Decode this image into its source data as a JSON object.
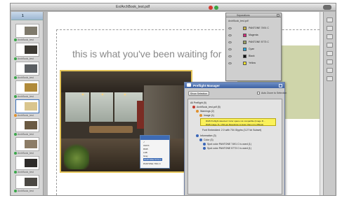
{
  "window": {
    "title": "Ex/ArchBook_test.pdf"
  },
  "pages_panel": {
    "header": "1",
    "thumbnails": [
      {
        "label": "ArchBook_test"
      },
      {
        "label": "ArchBook_test"
      },
      {
        "label": "ArchBook_test"
      },
      {
        "label": "ArchBook_test"
      },
      {
        "label": "ArchBook_test"
      },
      {
        "label": "ArchBook_test"
      },
      {
        "label": "ArchBook_test"
      },
      {
        "label": "ArchBook_test"
      },
      {
        "label": "ArchBook_test"
      }
    ]
  },
  "document": {
    "headline": "this is what you've been waiting for"
  },
  "separations": {
    "title": "Separations",
    "file": "ArchBook_test.pdf",
    "inks": [
      {
        "name": "PANTONE 7491 C",
        "color": "#c8b64a"
      },
      {
        "name": "Magenta",
        "color": "#d62a7a"
      },
      {
        "name": "PANTONE 5773 C",
        "color": "#9aa060"
      },
      {
        "name": "Cyan",
        "color": "#25a7de"
      },
      {
        "name": "Black",
        "color": "#111111"
      },
      {
        "name": "Yellow",
        "color": "#f3e12a"
      }
    ]
  },
  "popup_menu": {
    "items": [
      "✓",
      "CMYK",
      "RGB",
      "LAB",
      "Gray",
      "PANTONE 5773 C",
      "PANTONE 7491 C"
    ]
  },
  "preflight": {
    "title": "Preflight Manager",
    "button": "Show Selection",
    "checkbox_label": "Auto Zoom to Selection",
    "tree": {
      "all": "All Preflight (5)",
      "file": "ArchBook_test.pdf (5)",
      "warnings": "Warnings (2)",
      "images": "Image (1)",
      "highlight_line1": "RGB Preflight detected: Color space not compatible (Image R…",
      "highlight_line2": "RGB image 71 / 264 ppi Resolution is lower than min (150ppi)",
      "fonts_line": "Font Embedded: 2.0 with 704 Glyphs (3.27 kb Subset)",
      "information": "Information (3)",
      "color": "Color (3)",
      "spot1": "Spot color PANTONE 7491 C is used (1)",
      "spot2": "Spot color PANTONE 5773 C is used (1)"
    }
  }
}
